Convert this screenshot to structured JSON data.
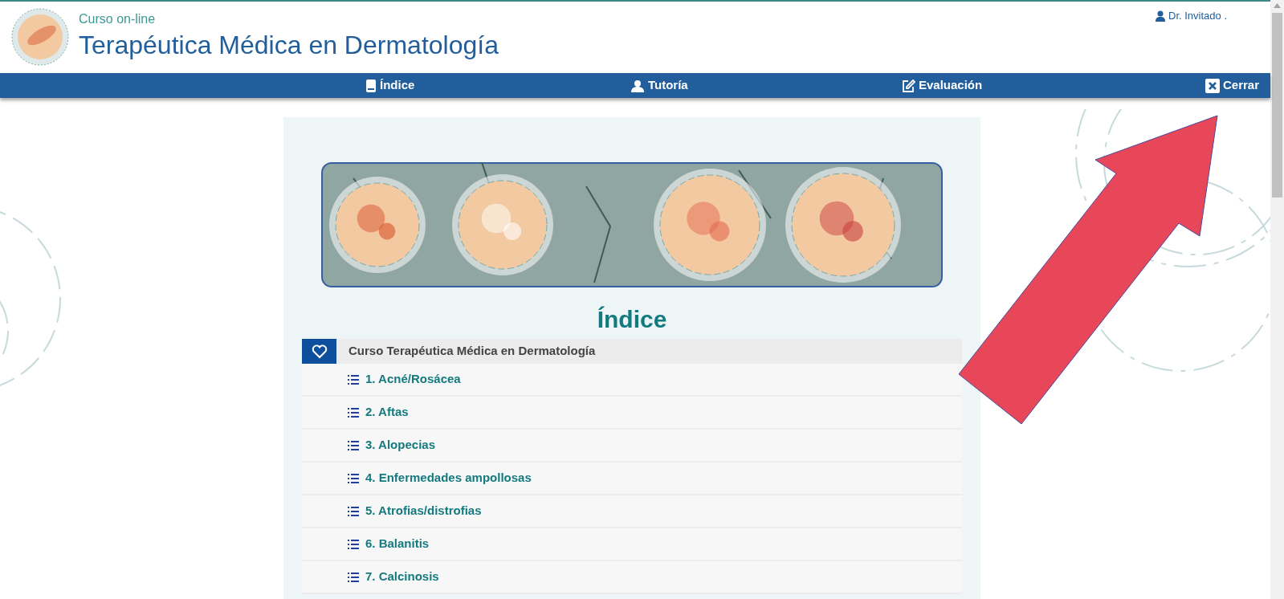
{
  "header": {
    "subtitle": "Curso on-line",
    "title": "Terapéutica Médica en Dermatología",
    "user": "Dr. Invitado ."
  },
  "nav": [
    {
      "label": "Índice",
      "kind": "book"
    },
    {
      "label": "Tutoría",
      "kind": "tutor"
    },
    {
      "label": "Evaluación",
      "kind": "edit"
    },
    {
      "label": "Cerrar",
      "kind": "close"
    }
  ],
  "index": {
    "title": "Índice",
    "course": "Curso Terapéutica Médica en Dermatología",
    "items": [
      "1. Acné/Rosácea",
      "2. Aftas",
      "3. Alopecias",
      "4. Enfermedades ampollosas",
      "5. Atrofias/distrofias",
      "6. Balanitis",
      "7. Calcinosis"
    ]
  }
}
